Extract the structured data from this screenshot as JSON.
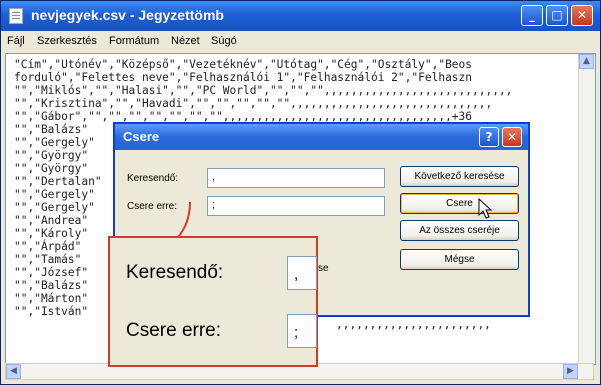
{
  "window": {
    "title": "nevjegyek.csv - Jegyzettömb",
    "menu": [
      "Fájl",
      "Szerkesztés",
      "Formátum",
      "Nézet",
      "Súgó"
    ],
    "buttons": {
      "minimize": "_",
      "maximize": "□",
      "close": "✕"
    }
  },
  "editor": {
    "lines": [
      "\"Cím\",\"Utónév\",\"Középső\",\"Vezetéknév\",\"Utótag\",\"Cég\",\"Osztály\",\"Beos",
      "forduló\",\"Felettes neve\",\"Felhasználói 1\",\"Felhasználói 2\",\"Felhaszn",
      "\"\",\"Miklós\",\"\",\"Halasi\",\"\",\"PC World\",\"\",\"\",\"\",,,,,,,,,,,,,,,,,,,,,,,,,,,,",
      "\"\",\"Krisztina\",\"\",\"Havadi\",\"\",\"\",\"\",\"\",\"\",,,,,,,,,,,,,,,,,,,,,,,,,,,,,,",
      "\"\",\"Gábor\",\"\",\"\",\"\",\"\",\"\",\"\",\"\",,,,,,,,,,,,,,,,,,,,,,,,,,,,,,,,,,+36",
      "\"\",\"Balázs\"",
      "\"\",\"Gergely\"",
      "\"\",\"György\"",
      "\"\",\"György\"",
      "\"\",\"Dertalan\"",
      "\"\",\"Gergely\"",
      "\"\",\"Gergely\"",
      "\"\",\"Andrea\"",
      "\"\",\"Károly\"",
      "\"\",\"Árpád\"",
      "\"\",\"Tamás\"",
      "\"\",\"József\"",
      "\"\",\"Balázs\"",
      "\"\",\"Márton\"",
      "\"\",\"István\""
    ]
  },
  "dialog": {
    "title": "Csere",
    "find_label": "Keresendő:",
    "find_value": ",",
    "replace_label": "Csere erre:",
    "replace_value": ";",
    "help": "?",
    "close": "✕",
    "btn_find_next": "Következő keresése",
    "btn_replace": "Csere",
    "btn_replace_all": "Az összes cseréje",
    "btn_cancel": "Mégse"
  },
  "zoom": {
    "find_label": "Keresendő:",
    "find_value": ",",
    "replace_label": "Csere erre:",
    "replace_value": ";",
    "peek_text": "se"
  },
  "colors": {
    "titlebar": "#1f5fd6",
    "callout_border": "#d3392c",
    "dialog_border": "#0a3fd0"
  }
}
